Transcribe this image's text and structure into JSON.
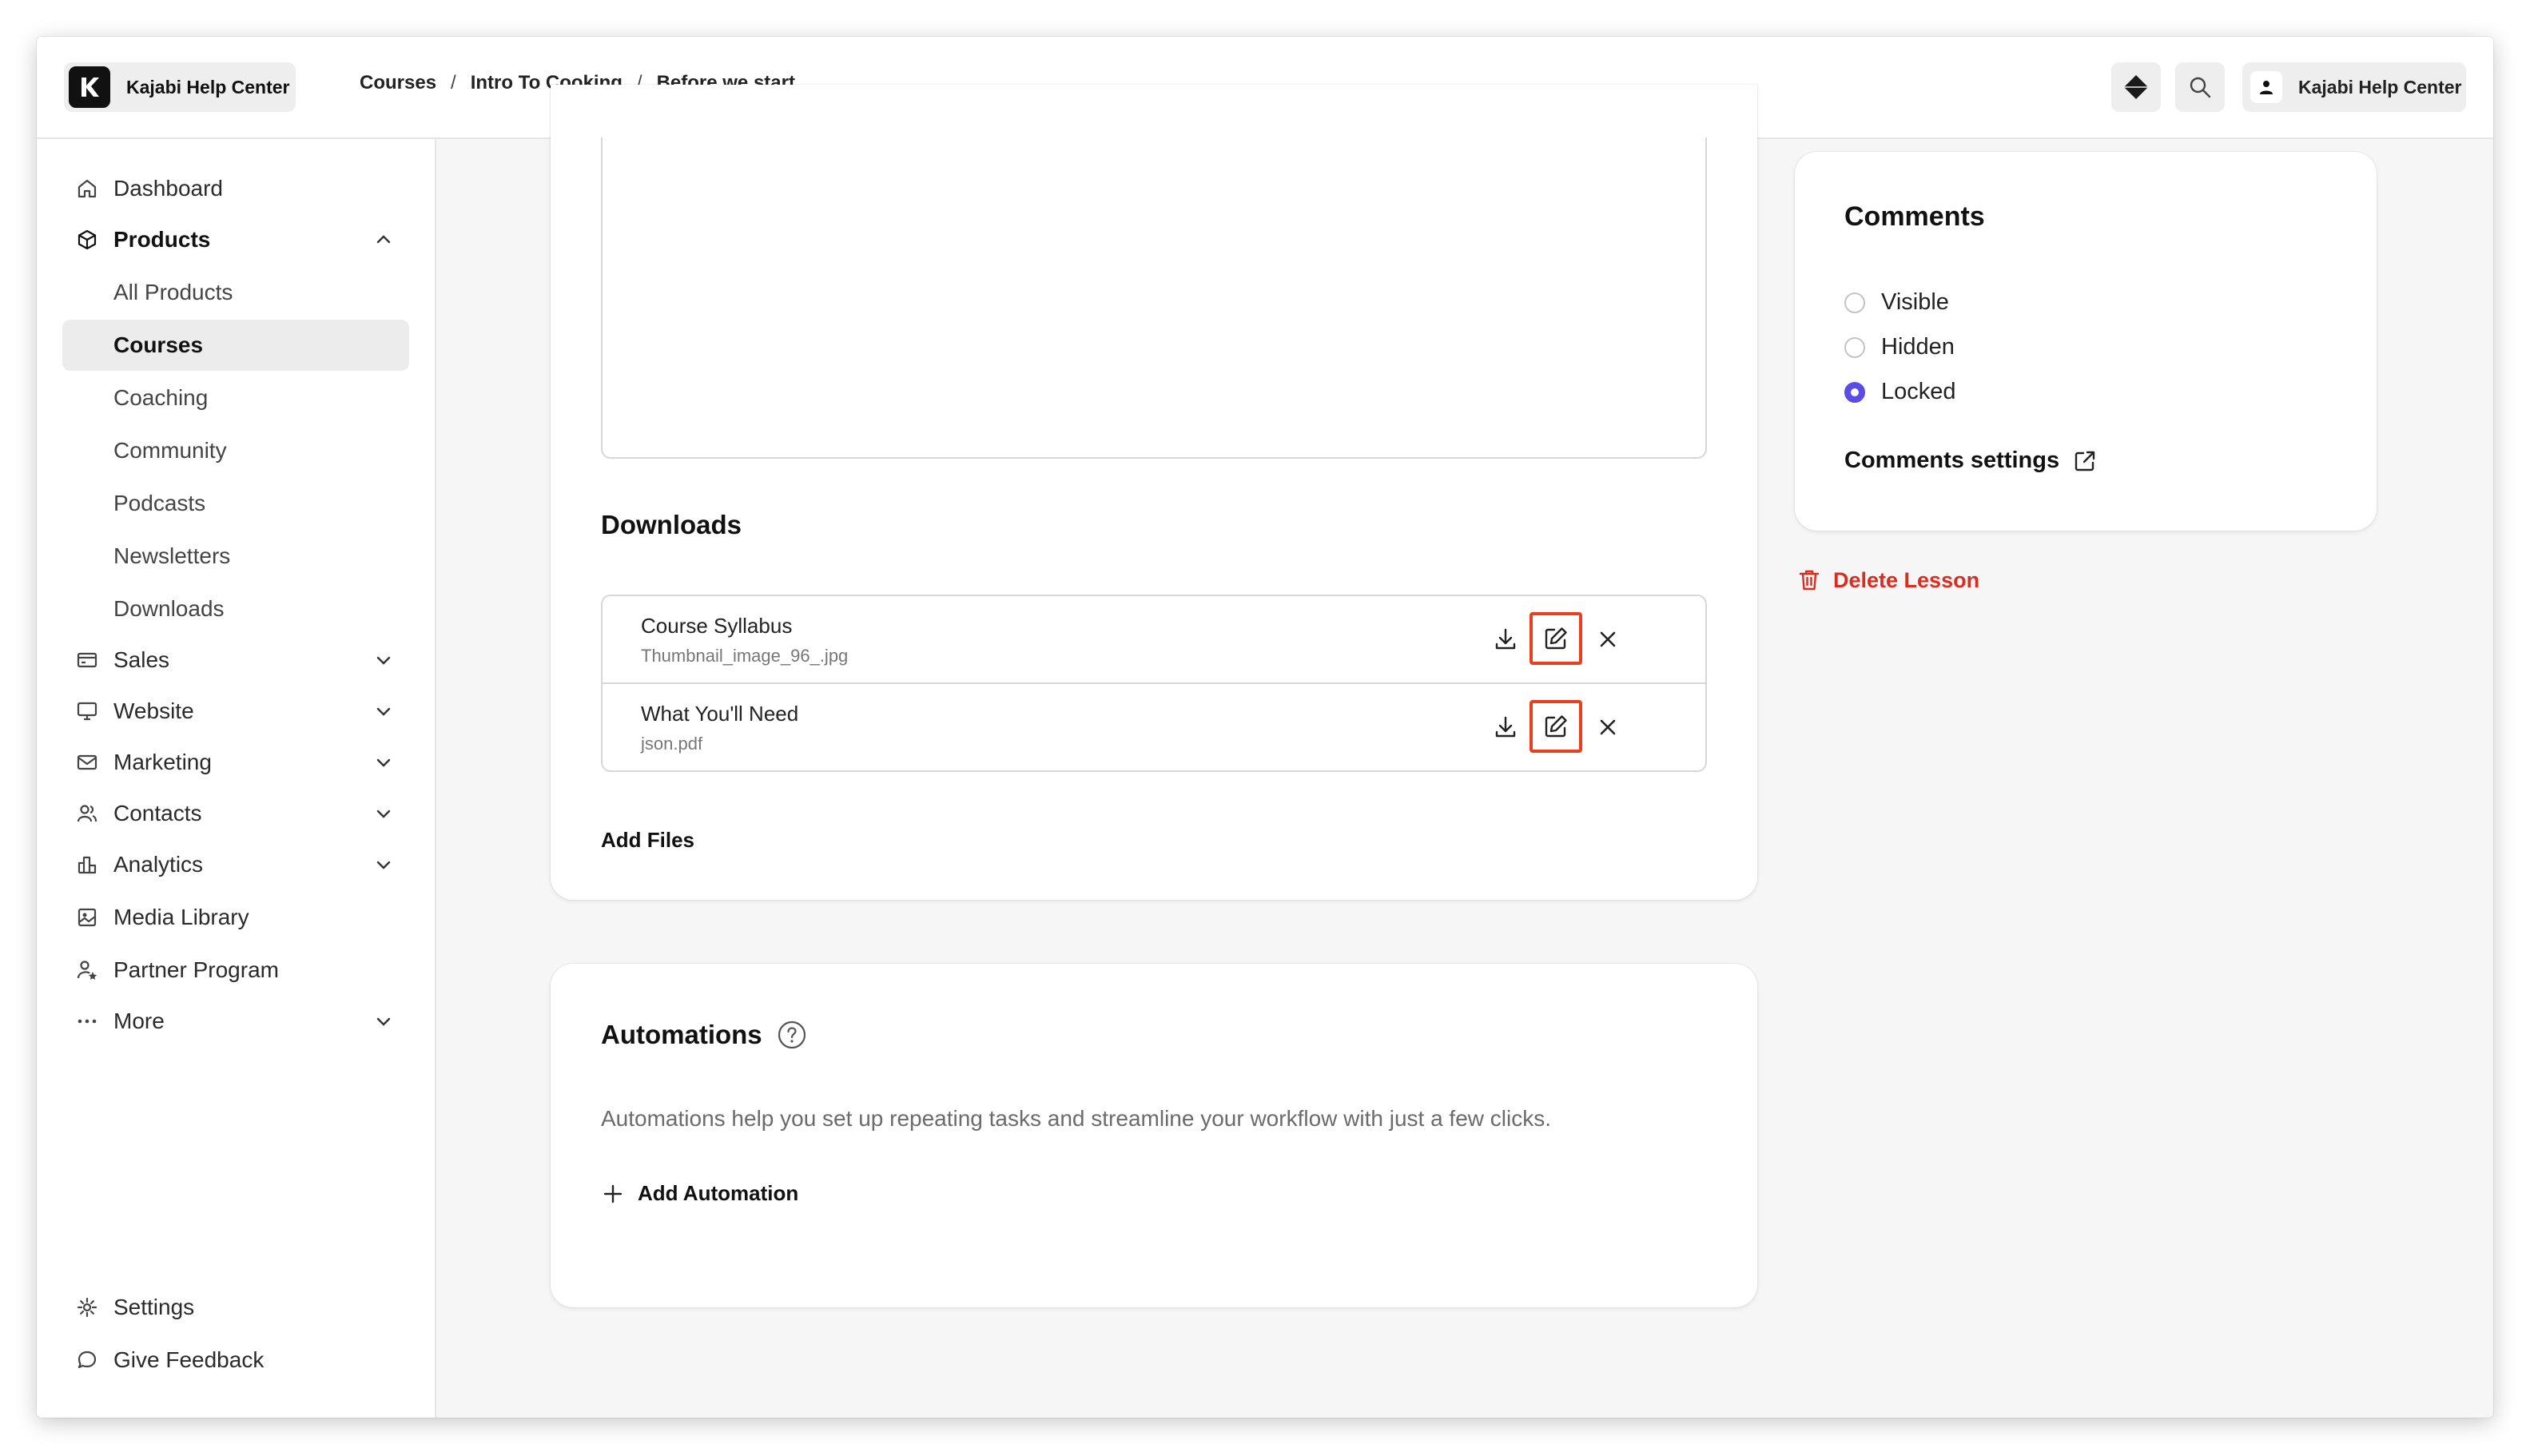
{
  "app": {
    "brand_name": "Kajabi Help Center",
    "account_name": "Kajabi Help Center"
  },
  "breadcrumb": [
    "Courses",
    "Intro To Cooking",
    "Before we start..."
  ],
  "sidebar": {
    "items": [
      {
        "label": "Dashboard",
        "icon": "home-icon"
      },
      {
        "label": "Products",
        "icon": "box-icon",
        "expanded": true
      },
      {
        "label": "Sales",
        "icon": "credit-card-icon"
      },
      {
        "label": "Website",
        "icon": "monitor-icon"
      },
      {
        "label": "Marketing",
        "icon": "mail-icon"
      },
      {
        "label": "Contacts",
        "icon": "users-icon"
      },
      {
        "label": "Analytics",
        "icon": "bar-chart-icon"
      },
      {
        "label": "Media Library",
        "icon": "image-icon"
      },
      {
        "label": "Partner Program",
        "icon": "user-star-icon"
      },
      {
        "label": "More",
        "icon": "ellipsis-icon"
      }
    ],
    "products_sub": [
      "All Products",
      "Courses",
      "Coaching",
      "Community",
      "Podcasts",
      "Newsletters",
      "Downloads"
    ],
    "active_sub": "Courses",
    "footer": [
      {
        "label": "Settings",
        "icon": "gear-icon"
      },
      {
        "label": "Give Feedback",
        "icon": "chat-bubble-icon"
      }
    ]
  },
  "downloads": {
    "title": "Downloads",
    "files": [
      {
        "name": "Course Syllabus",
        "file": "Thumbnail_image_96_.jpg"
      },
      {
        "name": "What You'll Need",
        "file": "json.pdf"
      }
    ],
    "add_files_label": "Add Files"
  },
  "automations": {
    "title": "Automations",
    "description": "Automations help you set up repeating tasks and streamline your workflow with just a few clicks.",
    "add_label": "Add Automation"
  },
  "comments": {
    "title": "Comments",
    "options": [
      "Visible",
      "Hidden",
      "Locked"
    ],
    "selected": "Locked",
    "settings_label": "Comments settings"
  },
  "delete_lesson_label": "Delete Lesson",
  "colors": {
    "accent": "#5b4be7",
    "danger": "#d92d20",
    "highlight": "#e8401f"
  }
}
